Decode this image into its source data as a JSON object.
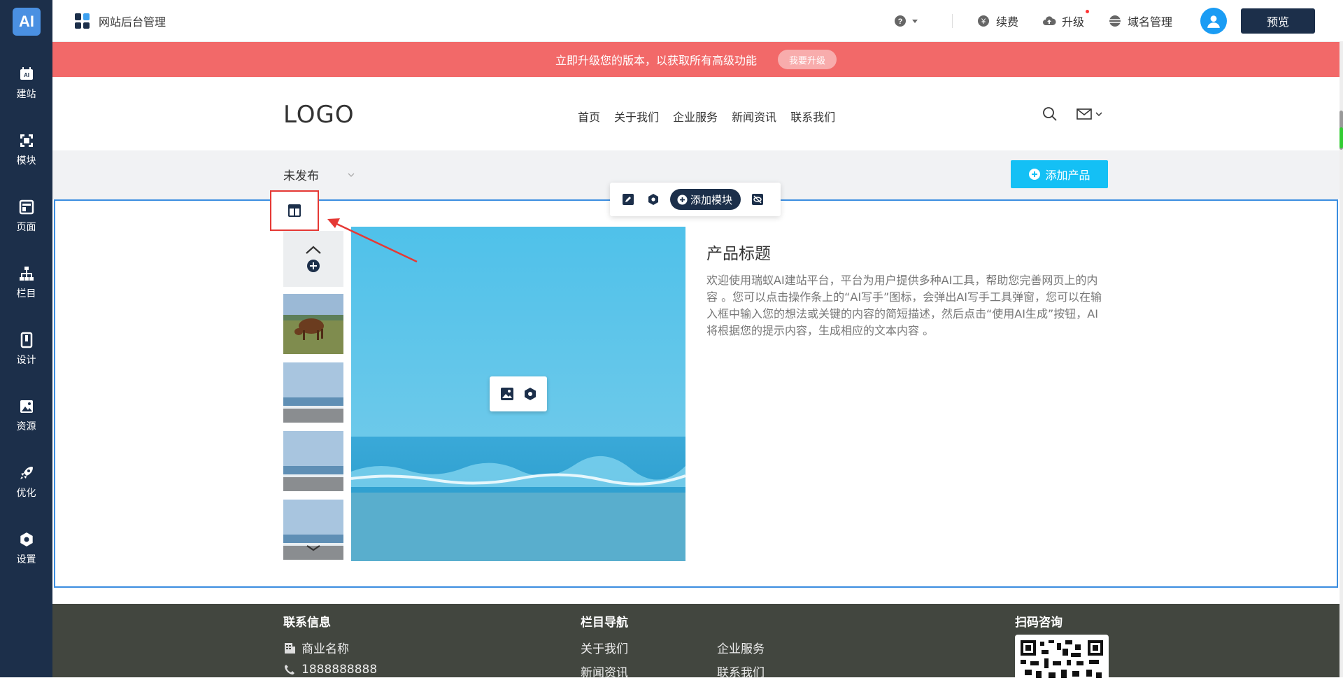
{
  "sidebar": {
    "logo": "AI",
    "items": [
      {
        "label": "建站"
      },
      {
        "label": "模块"
      },
      {
        "label": "页面"
      },
      {
        "label": "栏目"
      },
      {
        "label": "设计"
      },
      {
        "label": "资源"
      },
      {
        "label": "优化"
      },
      {
        "label": "设置"
      }
    ]
  },
  "topbar": {
    "title": "网站后台管理",
    "renew": "续费",
    "upgrade": "升级",
    "domain": "域名管理",
    "preview": "预览"
  },
  "banner": {
    "text": "立即升级您的版本，以获取所有高级功能",
    "button": "我要升级"
  },
  "site": {
    "logo": "LOGO",
    "nav": [
      "首页",
      "关于我们",
      "企业服务",
      "新闻资讯",
      "联系我们"
    ]
  },
  "product_toolbar": {
    "status": "未发布",
    "add_product": "添加产品"
  },
  "module_tools": {
    "add_module": "添加模块"
  },
  "product": {
    "title": "产品标题",
    "description": "欢迎使用瑞蚁AI建站平台，平台为用户提供多种AI工具，帮助您完善网页上的内容 。您可以点击操作条上的“AI写手”图标，会弹出AI写手工具弹窗，您可以在输入框中输入您的想法或关键的内容的简短描述，然后点击“使用AI生成”按钮，AI将根据您的提示内容，生成相应的文本内容 。"
  },
  "footer": {
    "contact_title": "联系信息",
    "company": "商业名称",
    "phone": "1888888888",
    "nav_title": "栏目导航",
    "nav_links": [
      "关于我们",
      "企业服务",
      "新闻资讯",
      "联系我们"
    ],
    "qr_title": "扫码咨询"
  },
  "colors": {
    "sidebar": "#1c2f4a",
    "banner": "#f26969",
    "accent": "#14c0f5",
    "module_border": "#3b8de0",
    "highlight": "#e53935",
    "footer": "#42463f"
  }
}
